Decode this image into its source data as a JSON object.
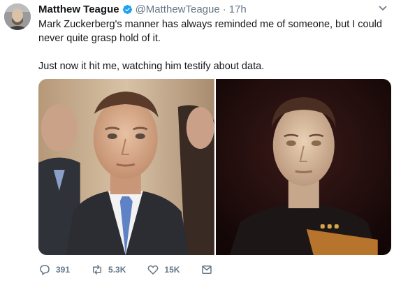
{
  "tweet": {
    "author_name": "Matthew Teague",
    "handle": "@MatthewTeague",
    "separator": "·",
    "time": "17h",
    "text_paragraph_1": "Mark Zuckerberg's manner has always reminded me of someone, but I could never quite grasp hold of it.",
    "text_paragraph_2": "Just now it hit me, watching him testify about data."
  },
  "actions": {
    "reply_count": "391",
    "retweet_count": "5.3K",
    "like_count": "15K"
  },
  "icons": {
    "verified": "verified-badge-icon",
    "caret": "chevron-down-icon",
    "reply": "reply-icon",
    "retweet": "retweet-icon",
    "like": "heart-icon",
    "dm": "envelope-icon"
  },
  "colors": {
    "text": "#14171a",
    "muted": "#657786",
    "verified": "#1da1f2"
  }
}
